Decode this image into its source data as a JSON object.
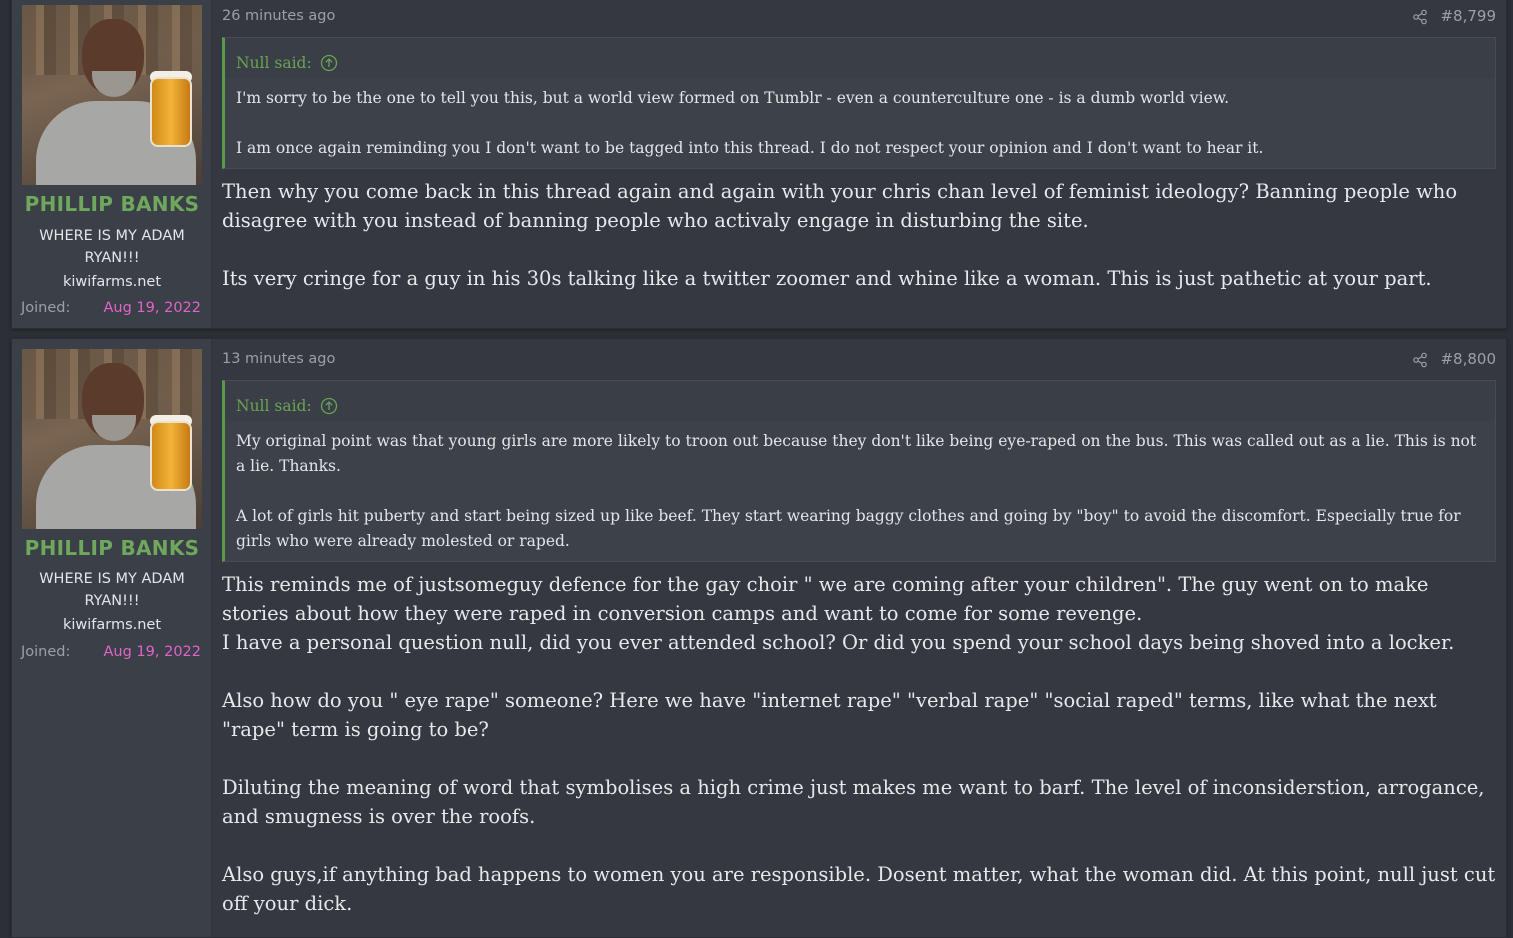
{
  "posts": [
    {
      "author": {
        "name": "PHILLIP BANKS",
        "title": "WHERE IS MY ADAM RYAN!!!",
        "banner": "kiwifarms.net",
        "joined_label": "Joined:",
        "joined_date": "Aug 19, 2022"
      },
      "time": "26 minutes ago",
      "number": "#8,799",
      "quote": {
        "author": "Null said:",
        "paragraphs": [
          "I'm sorry to be the one to tell you this, but a world view formed on Tumblr - even a counterculture one - is a dumb world view.",
          "I am once again reminding you I don't want to be tagged into this thread. I do not respect your opinion and I don't want to hear it."
        ]
      },
      "body": [
        "Then why you come back in this thread again and again with your chris chan level of feminist ideology? Banning people who disagree with you instead of banning people who activaly engage in disturbing the site.",
        "Its very cringe for a guy in his 30s talking like a twitter zoomer and whine like a woman. This is just pathetic at your part."
      ]
    },
    {
      "author": {
        "name": "PHILLIP BANKS",
        "title": "WHERE IS MY ADAM RYAN!!!",
        "banner": "kiwifarms.net",
        "joined_label": "Joined:",
        "joined_date": "Aug 19, 2022"
      },
      "time": "13 minutes ago",
      "number": "#8,800",
      "quote": {
        "author": "Null said:",
        "paragraphs": [
          "My original point was that young girls are more likely to troon out because they don't like being eye-raped on the bus. This was called out as a lie. This is not a lie. Thanks.",
          "A lot of girls hit puberty and start being sized up like beef. They start wearing baggy clothes and going by \"boy\" to avoid the discomfort. Especially true for girls who were already molested or raped."
        ]
      },
      "body": [
        "This reminds me of justsomeguy defence for the gay choir \" we are coming after your children\". The guy went on to make stories about how they were raped in conversion camps and want to come for some revenge.",
        "I have a personal question null, did you ever attended school? Or did you spend your school days being shoved into a locker.",
        "Also how do you \" eye rape\" someone? Here we have \"internet rape\" \"verbal rape\" \"social raped\" terms, like what the next \"rape\" term is going to be?",
        "Diluting the meaning of word that symbolises a high crime just makes me want to barf. The level of inconsiderstion, arrogance, and smugness is over the roofs.",
        "Also guys,if anything bad happens to women you are responsible. Dosent matter, what the woman did. At this point, null just cut off your dick."
      ]
    }
  ],
  "icons": {
    "share": "share-icon",
    "quote_jump": "arrow-up-circle-icon"
  },
  "colors": {
    "username": "#6fa85d",
    "joined_date": "#e064c8",
    "quote_border": "#5a9a48"
  }
}
